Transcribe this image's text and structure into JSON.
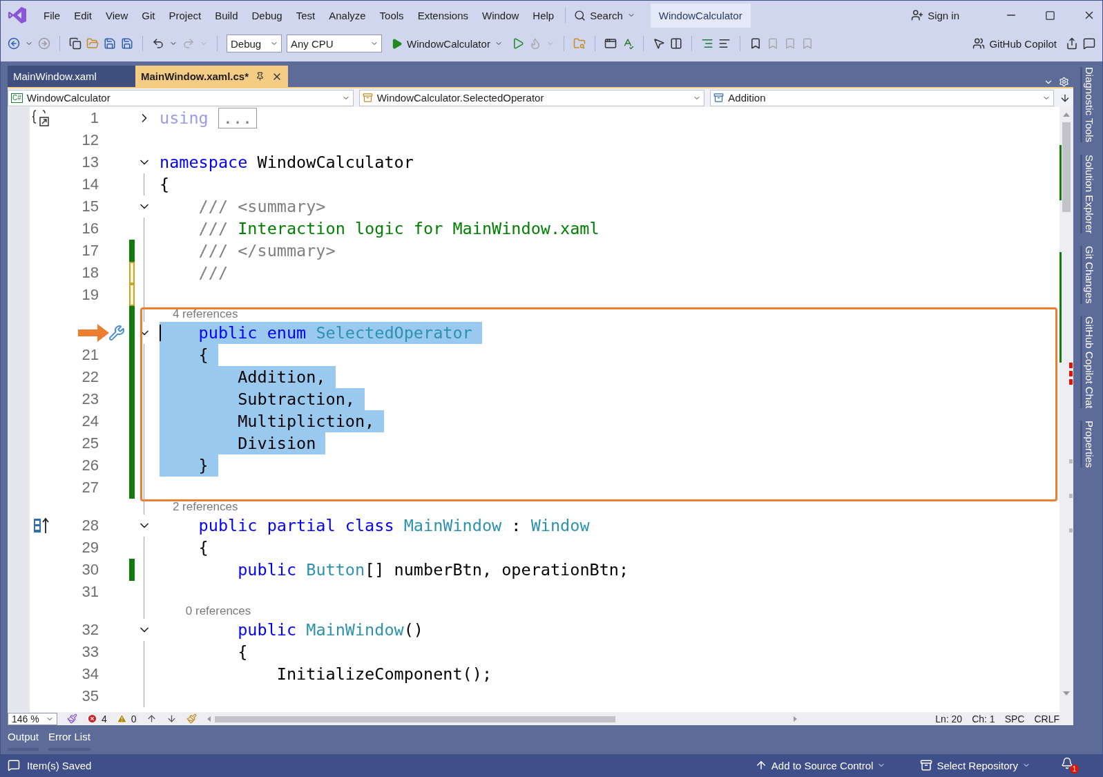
{
  "menu": [
    "File",
    "Edit",
    "View",
    "Git",
    "Project",
    "Build",
    "Debug",
    "Test",
    "Analyze",
    "Tools",
    "Extensions",
    "Window",
    "Help"
  ],
  "search": {
    "label": "Search"
  },
  "solution_name": "WindowCalculator",
  "sign_in": "Sign in",
  "toolbar": {
    "configuration": "Debug",
    "platform": "Any CPU",
    "run_target": "WindowCalculator",
    "copilot": "GitHub Copilot"
  },
  "tabs": [
    {
      "label": "MainWindow.xaml",
      "selected": false
    },
    {
      "label": "MainWindow.xaml.cs*",
      "selected": true
    }
  ],
  "nav_bar": {
    "project_badge": "C#",
    "project": "WindowCalculator",
    "type": "WindowCalculator.SelectedOperator",
    "member": "Addition"
  },
  "code": [
    {
      "kind": "line",
      "number": "1",
      "expanded": false,
      "gutter_icon": {
        "kind": "collapse"
      },
      "selected": false,
      "tokens": [
        {
          "text": "using",
          "kind": "faded"
        },
        {
          "text": "...",
          "kind": "collapsed"
        }
      ]
    },
    {
      "kind": "line",
      "number": "12"
    },
    {
      "kind": "line",
      "number": "13",
      "expanded": true,
      "selected": false,
      "tokens": [
        {
          "text": "namespace",
          "kind": "keyword"
        },
        {
          "text": " WindowCalculator",
          "kind": "plain"
        }
      ]
    },
    {
      "kind": "line",
      "number": "14",
      "selected": false,
      "tokens": [
        {
          "text": "{",
          "kind": "plain"
        }
      ]
    },
    {
      "kind": "line",
      "number": "15",
      "expanded": true,
      "selected": false,
      "tokens": [
        {
          "text": "    /// <summary>",
          "kind": "doc"
        }
      ]
    },
    {
      "kind": "line",
      "number": "16",
      "selected": false,
      "tokens": [
        {
          "text": "    /// ",
          "kind": "doc"
        },
        {
          "text": "Interaction logic for MainWindow.xaml",
          "kind": "comment"
        }
      ]
    },
    {
      "kind": "line",
      "number": "17",
      "modified": true,
      "saved": false,
      "selected": false,
      "tokens": [
        {
          "text": "    /// </summary>",
          "kind": "doc"
        }
      ]
    },
    {
      "kind": "line",
      "number": "18",
      "modified": true,
      "saved": true,
      "selected": false,
      "tokens": [
        {
          "text": "    ///",
          "kind": "doc"
        }
      ]
    },
    {
      "kind": "line",
      "number": "19",
      "modified": true,
      "saved": true
    },
    {
      "kind": "frame",
      "lines": [
        {
          "kind": "line",
          "lens": "4 references",
          "expanded": true,
          "modified": true,
          "saved": false,
          "selected": true,
          "caret": true,
          "arrow": true,
          "gutter_icon": {
            "kind": "quick-action"
          },
          "tokens": [
            {
              "text": "    public enum ",
              "kind": "keyword"
            },
            {
              "text": "SelectedOperator",
              "kind": "type"
            }
          ]
        },
        {
          "kind": "line",
          "number": "21",
          "modified": true,
          "saved": false,
          "selected": true,
          "tokens": [
            {
              "text": "    {",
              "kind": "plain"
            }
          ]
        },
        {
          "kind": "line",
          "number": "22",
          "modified": true,
          "saved": false,
          "selected": true,
          "tokens": [
            {
              "text": "        Addition,",
              "kind": "plain"
            }
          ]
        },
        {
          "kind": "line",
          "number": "23",
          "modified": true,
          "saved": false,
          "selected": true,
          "tokens": [
            {
              "text": "        Subtraction,",
              "kind": "plain"
            }
          ]
        },
        {
          "kind": "line",
          "number": "24",
          "modified": true,
          "saved": false,
          "selected": true,
          "tokens": [
            {
              "text": "        Multipliction,",
              "kind": "plain"
            }
          ]
        },
        {
          "kind": "line",
          "number": "25",
          "modified": true,
          "saved": false,
          "selected": true,
          "tokens": [
            {
              "text": "        Division",
              "kind": "plain"
            }
          ]
        },
        {
          "kind": "line",
          "number": "26",
          "modified": true,
          "saved": false,
          "selected": true,
          "tokens": [
            {
              "text": "    }",
              "kind": "plain"
            }
          ]
        },
        {
          "kind": "line",
          "number": "27",
          "modified": true,
          "saved": false
        }
      ]
    },
    {
      "kind": "line",
      "number": "28",
      "lens": "2 references",
      "expanded": true,
      "gutter_icon": {
        "kind": "inheritance"
      },
      "selected": false,
      "tokens": [
        {
          "text": "    public partial class ",
          "kind": "keyword"
        },
        {
          "text": "MainWindow",
          "kind": "type"
        },
        {
          "text": " : ",
          "kind": "plain"
        },
        {
          "text": "Window",
          "kind": "type"
        }
      ]
    },
    {
      "kind": "line",
      "number": "29",
      "selected": false,
      "tokens": [
        {
          "text": "    {",
          "kind": "plain"
        }
      ]
    },
    {
      "kind": "line",
      "number": "30",
      "modified": true,
      "saved": false,
      "selected": false,
      "tokens": [
        {
          "text": "        public ",
          "kind": "keyword"
        },
        {
          "text": "Button",
          "kind": "type"
        },
        {
          "text": "[] numberBtn, operationBtn;",
          "kind": "plain"
        }
      ]
    },
    {
      "kind": "line",
      "number": "31"
    },
    {
      "kind": "line",
      "number": "32",
      "lens": "0 references",
      "expanded": true,
      "selected": false,
      "tokens": [
        {
          "text": "        public ",
          "kind": "keyword"
        },
        {
          "text": "MainWindow",
          "kind": "type"
        },
        {
          "text": "()",
          "kind": "plain"
        }
      ]
    },
    {
      "kind": "line",
      "number": "33",
      "selected": false,
      "tokens": [
        {
          "text": "        {",
          "kind": "plain"
        }
      ]
    },
    {
      "kind": "line",
      "number": "34",
      "selected": false,
      "tokens": [
        {
          "text": "            InitializeComponent();",
          "kind": "plain"
        }
      ]
    },
    {
      "kind": "line",
      "number": "35"
    }
  ],
  "status_strip": {
    "zoom": "146 %",
    "errors": "4",
    "warnings": "0",
    "line": "Ln: 20",
    "column": "Ch: 1",
    "indent": "SPC",
    "line_ending": "CRLF"
  },
  "side_tabs": [
    "Diagnostic Tools",
    "Solution Explorer",
    "Git Changes",
    "GitHub Copilot Chat",
    "Properties"
  ],
  "bottom_tabs": [
    "Output",
    "Error List"
  ],
  "status_bar": {
    "message": "Item(s) Saved",
    "source_control": "Add to Source Control",
    "repository": "Select Repository",
    "notifications": "1"
  }
}
